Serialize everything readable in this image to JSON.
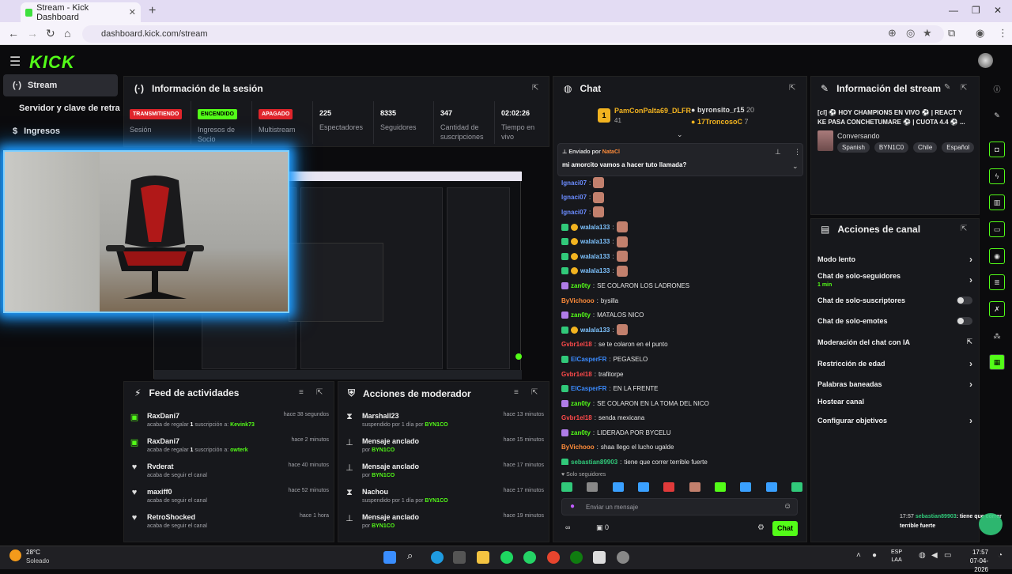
{
  "browser": {
    "tab_title": "Stream - Kick Dashboard",
    "url": "dashboard.kick.com/stream"
  },
  "brand": {
    "logo": "KICK",
    "accent": "#53fc18"
  },
  "sidebar": {
    "items": [
      {
        "label": "Stream"
      },
      {
        "label": "Servidor y clave de retransn"
      },
      {
        "label": "Ingresos"
      }
    ]
  },
  "session": {
    "title": "Información de la sesión",
    "badges": [
      {
        "label": "TRANSMITIENDO",
        "sub": "Sesión",
        "color": "#e0252b"
      },
      {
        "label": "ENCENDIDO",
        "sub": "Ingresos de Socio",
        "color": "#53fc18"
      },
      {
        "label": "APAGADO",
        "sub": "Multistream",
        "color": "#e0252b"
      }
    ],
    "stats": [
      {
        "value": "225",
        "label": "Espectadores"
      },
      {
        "value": "8335",
        "label": "Seguidores"
      },
      {
        "value": "347",
        "label": "Cantidad de suscripciones"
      },
      {
        "value": "02:02:26",
        "label": "Tiempo en vivo"
      }
    ]
  },
  "feed": {
    "title": "Feed de actividades",
    "items": [
      {
        "name": "RaxDani7",
        "time": "hace 38 segundos",
        "pre": "acaba de regalar",
        "num": "1",
        "mid": "suscripción a:",
        "target": "Kevink73",
        "icon": "gift-icon"
      },
      {
        "name": "RaxDani7",
        "time": "hace 2 minutos",
        "pre": "acaba de regalar",
        "num": "1",
        "mid": "suscripción a:",
        "target": "owterk",
        "icon": "gift-icon"
      },
      {
        "name": "Rvderat",
        "time": "hace 40 minutos",
        "pre": "acaba de seguir el canal",
        "icon": "heart-icon"
      },
      {
        "name": "maxiff0",
        "time": "hace 52 minutos",
        "pre": "acaba de seguir el canal",
        "icon": "heart-icon"
      },
      {
        "name": "RetroShocked",
        "time": "hace 1 hora",
        "pre": "acaba de seguir el canal",
        "icon": "heart-icon"
      }
    ]
  },
  "mod": {
    "title": "Acciones de moderador",
    "items": [
      {
        "name": "Marshall23",
        "time": "hace 13 minutos",
        "pre": "suspendido por 1 día por",
        "by": "BYN1CO",
        "icon": "hourglass-icon"
      },
      {
        "name": "Mensaje anclado",
        "time": "hace 15 minutos",
        "pre": "por",
        "by": "BYN1CO",
        "icon": "pin-icon"
      },
      {
        "name": "Mensaje anclado",
        "time": "hace 17 minutos",
        "pre": "por",
        "by": "BYN1CO",
        "icon": "pin-icon"
      },
      {
        "name": "Nachou",
        "time": "hace 17 minutos",
        "pre": "suspendido por 1 día por",
        "by": "BYN1CO",
        "icon": "hourglass-icon"
      },
      {
        "name": "Mensaje anclado",
        "time": "hace 19 minutos",
        "pre": "por",
        "by": "BYN1CO",
        "icon": "pin-icon"
      }
    ]
  },
  "chat": {
    "title": "Chat",
    "top": [
      {
        "name": "PamConPalta69_DLFR",
        "count": "41",
        "rank": "1"
      },
      {
        "name": "byronsito_r15",
        "count": "20"
      },
      {
        "name": "17TroncosoC",
        "count": "7"
      }
    ],
    "pinned": {
      "label": "Enviado por",
      "by": "NataCl",
      "text": "mi amorcito vamos a hacer tuto llamada?"
    },
    "messages": [
      {
        "user": "Ignaci07",
        "color": "#6b8cff",
        "text": "",
        "emote": true
      },
      {
        "user": "Ignaci07",
        "color": "#6b8cff",
        "text": "",
        "emote": true
      },
      {
        "user": "Ignaci07",
        "color": "#6b8cff",
        "text": "",
        "emote": true
      },
      {
        "user": "walala133",
        "color": "#7ec3ff",
        "text": "",
        "emote": true,
        "badges": "gy"
      },
      {
        "user": "walala133",
        "color": "#7ec3ff",
        "text": "",
        "emote": true,
        "badges": "gy"
      },
      {
        "user": "walala133",
        "color": "#7ec3ff",
        "text": "",
        "emote": true,
        "badges": "gy"
      },
      {
        "user": "walala133",
        "color": "#7ec3ff",
        "text": "",
        "emote": true,
        "badges": "gy"
      },
      {
        "user": "zan0ty",
        "color": "#53fc18",
        "text": "SE COLARON LOS LADRONES",
        "badges": "p"
      },
      {
        "user": "ByVichooo",
        "color": "#ff8c3a",
        "text": "bysilla",
        "badges": ""
      },
      {
        "user": "zan0ty",
        "color": "#53fc18",
        "text": "MATALOS NICO",
        "badges": "p"
      },
      {
        "user": "walala133",
        "color": "#7ec3ff",
        "text": "",
        "emote": true,
        "badges": "gy"
      },
      {
        "user": "Gvbr1el18",
        "color": "#ff4a4a",
        "text": "se te colaron en el punto",
        "badges": ""
      },
      {
        "user": "ElCasperFR",
        "color": "#3b8bff",
        "text": "PEGASELO",
        "badges": "g"
      },
      {
        "user": "Gvbr1el18",
        "color": "#ff4a4a",
        "text": "trafitorpe",
        "badges": ""
      },
      {
        "user": "ElCasperFR",
        "color": "#3b8bff",
        "text": "EN LA FRENTE",
        "badges": "g"
      },
      {
        "user": "zan0ty",
        "color": "#53fc18",
        "text": "SE COLARON EN LA TOMA DEL NICO",
        "badges": "p"
      },
      {
        "user": "Gvbr1el18",
        "color": "#ff4a4a",
        "text": "senda mexicana",
        "badges": ""
      },
      {
        "user": "zan0ty",
        "color": "#53fc18",
        "text": "LIDERADA POR BYCELU",
        "badges": "p"
      },
      {
        "user": "ByVichooo",
        "color": "#ff8c3a",
        "text": "shaa llego el lucho ugalde",
        "badges": ""
      },
      {
        "user": "sebastian89903",
        "color": "#31c97a",
        "text": "tiene que correr terrible fuerte",
        "badges": "g"
      }
    ],
    "followers_only": "Solo seguidores",
    "placeholder": "Enviar un mensaje",
    "count": "0",
    "send": "Chat"
  },
  "streaminfo": {
    "title": "Información del stream",
    "text": "[cl] ⚽ HOY CHAMPIONS EN VIVO ⚽ | REACT Y KE PASA CONCHETUMARE ⚽ | CUOTA 4.4 ⚽ ...",
    "category": "Conversando",
    "tags": [
      "Spanish",
      "BYN1C0",
      "Chile",
      "Español"
    ]
  },
  "actions": {
    "title": "Acciones de canal",
    "items": [
      {
        "label": "Modo lento",
        "type": "chev"
      },
      {
        "label": "Chat de solo-seguidores",
        "sub": "1 min",
        "type": "chev"
      },
      {
        "label": "Chat de solo-suscriptores",
        "type": "toggle"
      },
      {
        "label": "Chat de solo-emotes",
        "type": "toggle"
      },
      {
        "label": "Moderación del chat con IA",
        "type": "ext"
      },
      {
        "label": "Restricción de edad",
        "type": "chev"
      },
      {
        "label": "Palabras baneadas",
        "type": "chev"
      },
      {
        "label": "Hostear canal",
        "type": "none"
      },
      {
        "label": "Configurar objetivos",
        "type": "chev"
      }
    ]
  },
  "overlay_chat": {
    "time": "17:57",
    "user": "sebastian89903",
    "text": "tiene que correr terrible fuerte"
  },
  "taskbar": {
    "weather_temp": "28°C",
    "weather_text": "Soleado",
    "lang1": "ESP",
    "lang2": "LAA",
    "time": "17:57",
    "date": "07-04-2026"
  }
}
